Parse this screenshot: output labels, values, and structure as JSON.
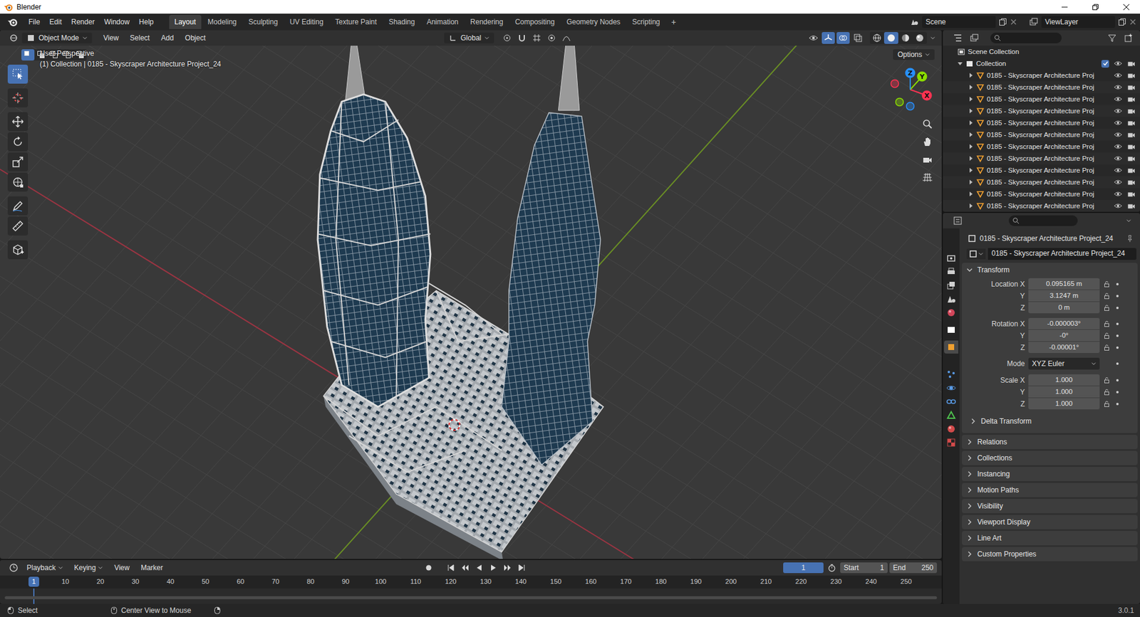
{
  "window": {
    "title": "Blender"
  },
  "menus": [
    "File",
    "Edit",
    "Render",
    "Window",
    "Help"
  ],
  "workspaces": [
    {
      "label": "Layout",
      "selected": true
    },
    {
      "label": "Modeling",
      "selected": false
    },
    {
      "label": "Sculpting",
      "selected": false
    },
    {
      "label": "UV Editing",
      "selected": false
    },
    {
      "label": "Texture Paint",
      "selected": false
    },
    {
      "label": "Shading",
      "selected": false
    },
    {
      "label": "Animation",
      "selected": false
    },
    {
      "label": "Rendering",
      "selected": false
    },
    {
      "label": "Compositing",
      "selected": false
    },
    {
      "label": "Geometry Nodes",
      "selected": false
    },
    {
      "label": "Scripting",
      "selected": false
    }
  ],
  "add_workspace": "+",
  "scene": "Scene",
  "view_layer": "ViewLayer",
  "viewport": {
    "mode": "Object Mode",
    "menus": [
      "View",
      "Select",
      "Add",
      "Object"
    ],
    "orientation": "Global",
    "options": "Options",
    "perspective": "User Perspective",
    "context": "(1) Collection | 0185 - Skyscraper Architecture Project_24",
    "select_modes": [
      {
        "kind": "new",
        "selected": true
      },
      {
        "kind": "extend",
        "selected": false
      },
      {
        "kind": "subtract",
        "selected": false
      },
      {
        "kind": "invert",
        "selected": false
      },
      {
        "kind": "intersect",
        "selected": false
      }
    ],
    "tools": [
      {
        "kind": "select",
        "selected": true
      },
      {
        "kind": "cursor",
        "selected": false
      },
      {
        "kind": "move",
        "selected": false
      },
      {
        "kind": "rotate",
        "selected": false
      },
      {
        "kind": "scale",
        "selected": false
      },
      {
        "kind": "transform",
        "selected": false
      },
      {
        "kind": "annotate",
        "selected": false
      },
      {
        "kind": "measure",
        "selected": false
      },
      {
        "kind": "add",
        "selected": false
      }
    ],
    "shading": [
      {
        "kind": "wireframe",
        "selected": false
      },
      {
        "kind": "solid",
        "selected": true
      },
      {
        "kind": "material",
        "selected": false
      },
      {
        "kind": "rendered",
        "selected": false
      }
    ],
    "gizmo_axes": [
      {
        "label": "X",
        "color": "#ff3352"
      },
      {
        "label": "Y",
        "color": "#8bdc00"
      },
      {
        "label": "Z",
        "color": "#2890ff"
      }
    ]
  },
  "outliner": {
    "root": "Scene Collection",
    "collection": {
      "label": "Collection",
      "checked": true,
      "expanded": true
    },
    "items": [
      {
        "label": "0185 - Skyscraper Architecture Proj",
        "expanded": false
      },
      {
        "label": "0185 - Skyscraper Architecture Proj",
        "expanded": false
      },
      {
        "label": "0185 - Skyscraper Architecture Proj",
        "expanded": false
      },
      {
        "label": "0185 - Skyscraper Architecture Proj",
        "expanded": false
      },
      {
        "label": "0185 - Skyscraper Architecture Proj",
        "expanded": false
      },
      {
        "label": "0185 - Skyscraper Architecture Proj",
        "expanded": false
      },
      {
        "label": "0185 - Skyscraper Architecture Proj",
        "expanded": false
      },
      {
        "label": "0185 - Skyscraper Architecture Proj",
        "expanded": false
      },
      {
        "label": "0185 - Skyscraper Architecture Proj",
        "expanded": false
      },
      {
        "label": "0185 - Skyscraper Architecture Proj",
        "expanded": false
      },
      {
        "label": "0185 - Skyscraper Architecture Proj",
        "expanded": false
      },
      {
        "label": "0185 - Skyscraper Architecture Proj",
        "expanded": false
      }
    ]
  },
  "properties": {
    "object": "0185 - Skyscraper Architecture Project_24",
    "name_field": "0185 - Skyscraper Architecture Project_24",
    "tabs": [
      {
        "kind": "tool",
        "selected": false
      },
      {
        "kind": "render",
        "selected": false
      },
      {
        "kind": "output",
        "selected": false
      },
      {
        "kind": "view_layer",
        "selected": false
      },
      {
        "kind": "scene",
        "selected": false
      },
      {
        "kind": "world",
        "selected": false
      },
      {
        "kind": "collection",
        "selected": false
      },
      {
        "kind": "object",
        "selected": true
      },
      {
        "kind": "modifiers",
        "selected": false
      },
      {
        "kind": "particles",
        "selected": false
      },
      {
        "kind": "physics",
        "selected": false
      },
      {
        "kind": "constraints",
        "selected": false
      },
      {
        "kind": "data",
        "selected": false
      },
      {
        "kind": "material",
        "selected": false
      },
      {
        "kind": "texture",
        "selected": false
      }
    ],
    "transform": {
      "title": "Transform",
      "expanded": true,
      "location": [
        {
          "label": "Location X",
          "value": "0.095165 m"
        },
        {
          "label": "Y",
          "value": "3.1247 m"
        },
        {
          "label": "Z",
          "value": "0 m"
        }
      ],
      "rotation": [
        {
          "label": "Rotation X",
          "value": "-0.000003°"
        },
        {
          "label": "Y",
          "value": "-0°"
        },
        {
          "label": "Z",
          "value": "-0.00001°"
        }
      ],
      "mode": {
        "label": "Mode",
        "value": "XYZ Euler"
      },
      "scale": [
        {
          "label": "Scale X",
          "value": "1.000"
        },
        {
          "label": "Y",
          "value": "1.000"
        },
        {
          "label": "Z",
          "value": "1.000"
        }
      ],
      "subpanel": {
        "title": "Delta Transform",
        "expanded": false
      }
    },
    "panels": [
      {
        "title": "Relations",
        "expanded": false
      },
      {
        "title": "Collections",
        "expanded": false
      },
      {
        "title": "Instancing",
        "expanded": false
      },
      {
        "title": "Motion Paths",
        "expanded": false
      },
      {
        "title": "Visibility",
        "expanded": false
      },
      {
        "title": "Viewport Display",
        "expanded": false
      },
      {
        "title": "Line Art",
        "expanded": false
      },
      {
        "title": "Custom Properties",
        "expanded": false
      }
    ]
  },
  "timeline": {
    "menus": [
      {
        "label": "Playback",
        "dropdown": true
      },
      {
        "label": "Keying",
        "dropdown": true
      },
      {
        "label": "View",
        "dropdown": false
      },
      {
        "label": "Marker",
        "dropdown": false
      }
    ],
    "frame": "1",
    "start_label": "Start",
    "start": "1",
    "end_label": "End",
    "end": "250",
    "playhead": "1",
    "ruler": [
      "10",
      "20",
      "30",
      "40",
      "50",
      "60",
      "70",
      "80",
      "90",
      "100",
      "110",
      "120",
      "130",
      "140",
      "150",
      "160",
      "170",
      "180",
      "190",
      "200",
      "210",
      "220",
      "230",
      "240",
      "250"
    ]
  },
  "status_bar": {
    "hints": [
      "Select",
      "Center View to Mouse"
    ],
    "version": "3.0.1"
  }
}
